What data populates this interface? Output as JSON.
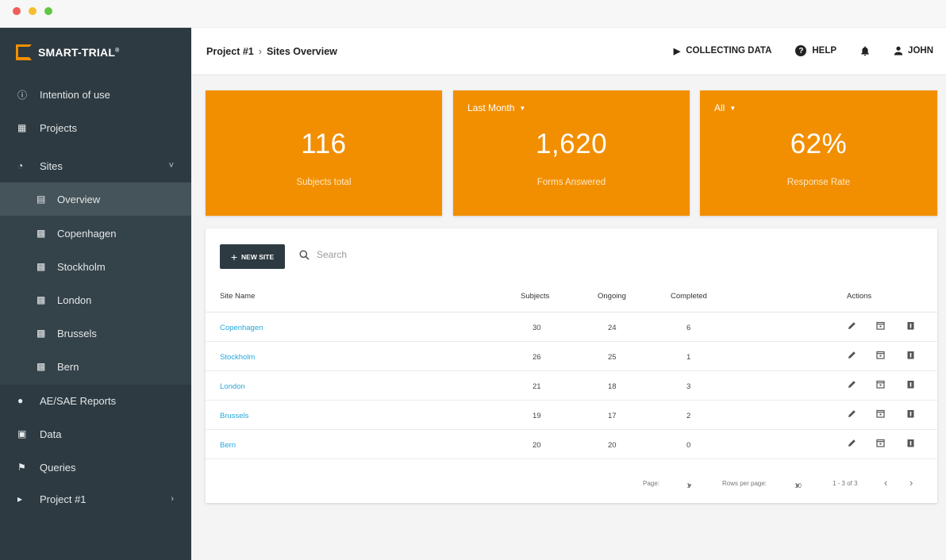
{
  "window": {
    "dots": [
      "#ee5e57",
      "#f6be2f",
      "#5ec840"
    ]
  },
  "brand": {
    "name": "SMART-TRIAL",
    "mark": "®",
    "color": "#f28f00"
  },
  "sidebar": {
    "items": [
      {
        "label": "Intention of use",
        "icon": "info-icon",
        "glyph": "ⓘ"
      },
      {
        "label": "Projects",
        "icon": "grid-icon",
        "glyph": "▦"
      },
      {
        "label": "Sites",
        "icon": "globe-icon",
        "glyph": "◔",
        "chevron": "˅"
      },
      {
        "label": "Overview",
        "icon": "calendar-icon",
        "glyph": "▤"
      },
      {
        "label": "Copenhagen",
        "icon": "building-icon",
        "glyph": "▩"
      },
      {
        "label": "Stockholm",
        "icon": "building-icon",
        "glyph": "▩"
      },
      {
        "label": "London",
        "icon": "building-icon",
        "glyph": "▩"
      },
      {
        "label": "Brussels",
        "icon": "building-icon",
        "glyph": "▩"
      },
      {
        "label": "Bern",
        "icon": "building-icon",
        "glyph": "▩"
      },
      {
        "label": "AE/SAE Reports",
        "icon": "alert-icon",
        "glyph": "●"
      },
      {
        "label": "Data",
        "icon": "chart-icon",
        "glyph": "▣"
      },
      {
        "label": "Queries",
        "icon": "flag-icon",
        "glyph": "⚑"
      },
      {
        "label": "Project #1",
        "icon": "play-icon",
        "glyph": "▸",
        "chevron": "›"
      }
    ]
  },
  "header": {
    "breadcrumb": [
      "Project #1",
      "Sites Overview"
    ],
    "separator": "›",
    "status_label": "COLLECTING DATA",
    "help_label": "HELP",
    "user_label": "JOHN"
  },
  "cards": [
    {
      "dropdown": "",
      "value": "116",
      "label": "Subjects total"
    },
    {
      "dropdown": "Last Month",
      "value": "1,620",
      "label": "Forms Answered"
    },
    {
      "dropdown": "All",
      "value": "62%",
      "label": "Response Rate"
    }
  ],
  "table": {
    "new_button": "NEW SITE",
    "search_placeholder": "Search",
    "columns": [
      "Site Name",
      "Subjects",
      "Ongoing",
      "Completed",
      "Actions"
    ],
    "rows": [
      {
        "site": "Copenhagen",
        "subjects": "30",
        "ongoing": "24",
        "completed": "6"
      },
      {
        "site": "Stockholm",
        "subjects": "26",
        "ongoing": "25",
        "completed": "1"
      },
      {
        "site": "London",
        "subjects": "21",
        "ongoing": "18",
        "completed": "3"
      },
      {
        "site": "Brussels",
        "subjects": "19",
        "ongoing": "17",
        "completed": "2"
      },
      {
        "site": "Bern",
        "subjects": "20",
        "ongoing": "20",
        "completed": "0"
      }
    ],
    "footer": {
      "page_label": "Page:",
      "page_value": "1",
      "rows_label": "Rows per page:",
      "rows_value": "10",
      "range": "1 - 3 of 3"
    }
  }
}
